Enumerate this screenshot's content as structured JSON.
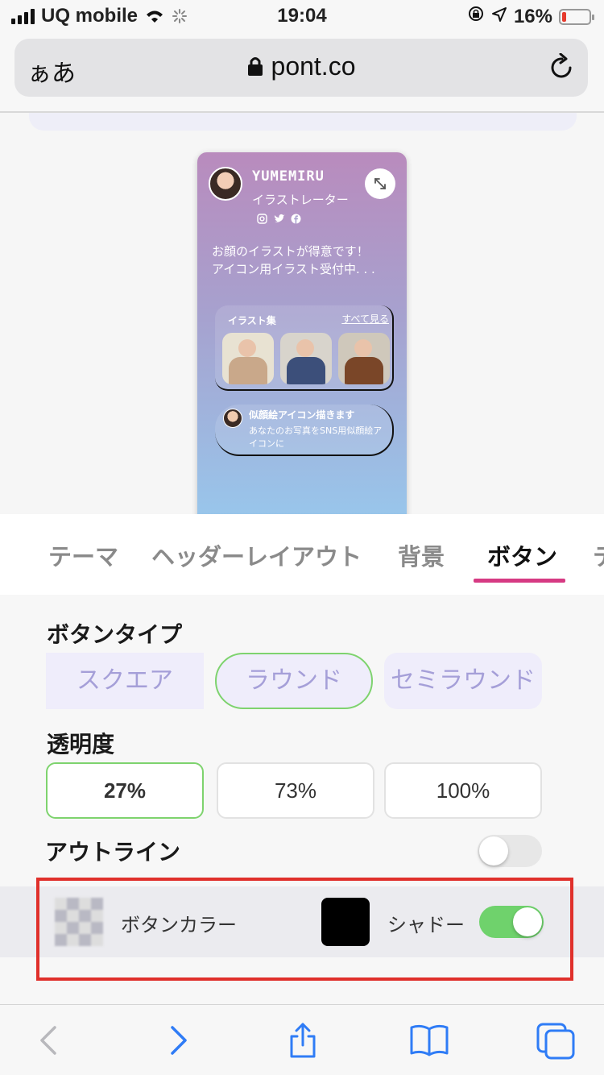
{
  "status_bar": {
    "carrier": "UQ mobile",
    "time": "19:04",
    "battery_percent": "16%",
    "battery_level": 0.16,
    "battery_color": "#e63b2e"
  },
  "url_bar": {
    "aa_label": "ぁあ",
    "domain": "pont.co"
  },
  "preview": {
    "name": "YUMEMIRU",
    "role": "イラストレーター",
    "social_icons": [
      "instagram-icon",
      "twitter-icon",
      "facebook-icon"
    ],
    "bio": "お顔のイラストが得意です！\nアイコン用イラスト受付中. . .",
    "gallery": {
      "title": "イラスト集",
      "view_all": "すべて見る"
    },
    "link_card": {
      "title": "似顔絵アイコン描きます",
      "description": "あなたのお写真をSNS用似顔絵アイコンに"
    }
  },
  "tabs": [
    {
      "label": "テーマ",
      "active": false
    },
    {
      "label": "ヘッダーレイアウト",
      "active": false
    },
    {
      "label": "背景",
      "active": false
    },
    {
      "label": "ボタン",
      "active": true
    },
    {
      "label": "テ",
      "active": false
    }
  ],
  "button_type": {
    "label": "ボタンタイプ",
    "options": [
      "スクエア",
      "ラウンド",
      "セミラウンド"
    ],
    "selected": "ラウンド"
  },
  "opacity": {
    "label": "透明度",
    "options": [
      "27%",
      "73%",
      "100%"
    ],
    "selected": "27%"
  },
  "outline": {
    "label": "アウトライン",
    "enabled": false
  },
  "color_row": {
    "button_color_label": "ボタンカラー",
    "shadow_label": "シャドー",
    "shadow_color": "#000000",
    "shadow_enabled": true
  },
  "colors": {
    "accent_underline": "#d63a83",
    "selected_border": "#7ed36e",
    "toggle_on": "#6fd26c",
    "highlight_box": "#e0302b",
    "ios_blue": "#2f7cf6"
  },
  "toolbar": {
    "icons": [
      "back-icon",
      "forward-icon",
      "share-icon",
      "bookmarks-icon",
      "tabs-icon"
    ]
  }
}
